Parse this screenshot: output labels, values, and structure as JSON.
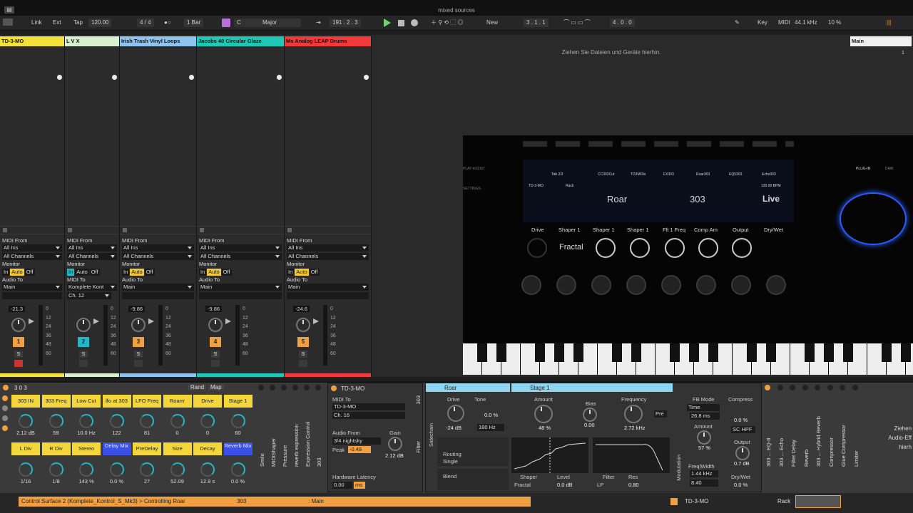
{
  "window": {
    "title": "mixed sources",
    "menu_glyph": "▤"
  },
  "transport": {
    "link": "Link",
    "ext": "Ext",
    "tap": "Tap",
    "tempo": "120.00",
    "meter": "4 / 4",
    "quant": "1 Bar",
    "key": "C",
    "scale": "Major",
    "position": "191 . 2 . 3",
    "new": "New",
    "loop_start": "3 . 1 . 1",
    "loop_len": "4 . 0 . 0",
    "key_btn": "Key",
    "midi": "MIDI",
    "sample_rate": "44.1 kHz",
    "cpu": "10 %"
  },
  "tracks": [
    {
      "name": "TD-3-MO",
      "color": "#f3e23a",
      "midi_from": "All Ins",
      "channels": "All Channels",
      "monitor": "auto",
      "audio_to": "Main",
      "sub": "",
      "volume": "-21.3",
      "number": "1",
      "numcolor": "#f0a040"
    },
    {
      "name": "L V X",
      "color": "#d8f0d0",
      "midi_from": "All Ins",
      "channels": "All Channels",
      "monitor": "in",
      "audio_to": "Komplete Kont",
      "sub": "Ch. 12",
      "volume": "",
      "number": "2",
      "numcolor": "#1fb8c8"
    },
    {
      "name": "Irish Trash Vinyl Loops",
      "color": "#8fc4f0",
      "midi_from": "All Ins",
      "channels": "All Channels",
      "monitor": "auto",
      "audio_to": "Main",
      "sub": "",
      "volume": "-9.86",
      "number": "3",
      "numcolor": "#f0a040"
    },
    {
      "name": "Jacobs 40 Circular Glaze",
      "color": "#1ec8b4",
      "midi_from": "All Ins",
      "channels": "All Channels",
      "monitor": "auto",
      "audio_to": "Main",
      "sub": "",
      "volume": "-9.86",
      "number": "4",
      "numcolor": "#f0a040"
    },
    {
      "name": "Ms Analog LEAP Drums",
      "color": "#f23a3a",
      "midi_from": "All Ins",
      "channels": "All Channels",
      "monitor": "auto",
      "audio_to": "Main",
      "sub": "",
      "volume": "-24.6",
      "number": "5",
      "numcolor": "#f0a040"
    }
  ],
  "labels": {
    "midi_from": "MIDI From",
    "monitor": "Monitor",
    "audio_to": "Audio To",
    "midi_to": "MIDI To",
    "in": "In",
    "auto": "Auto",
    "off": "Off",
    "s": "S",
    "meter_scale": [
      "0",
      "12",
      "24",
      "36",
      "48",
      "60"
    ]
  },
  "main_track": {
    "name": "Main",
    "num": "1"
  },
  "drop_message": "Ziehen Sie Dateien und Geräte hierhin.",
  "video": {
    "tab": "Tab 2/3",
    "tabs": [
      "CC303Cut",
      "TD3MOin",
      "FX303",
      "Roar303",
      "EQ5303",
      "Echo303"
    ],
    "track": "TD-3-MO",
    "rack": "Rack",
    "bpm": "120.00 BPM",
    "big_left": "Roar",
    "big_mid": "303",
    "big_right": "Live",
    "params": [
      "Drive",
      "Shaper 1",
      "Shaper 1",
      "Shaper 1",
      "Flt 1 Freq",
      "Comp Am",
      "Output",
      "Dry/Wet"
    ],
    "fractal": "Fractal",
    "top_left": "PLAY ASSIST",
    "top_left2": "SETTINGS",
    "plugin": "PLUG-IN",
    "daw": "DAW"
  },
  "rack": {
    "header": "3 0 3",
    "rand": "Rand",
    "map": "Map",
    "macros_top": [
      {
        "label": "303 IN",
        "value": "2.12 dB"
      },
      {
        "label": "303 Freq",
        "value": "59"
      },
      {
        "label": "Low Cut",
        "value": "10.0 Hz"
      },
      {
        "label": "lfo at 303",
        "value": "122"
      },
      {
        "label": "LFO Freq",
        "value": "81"
      },
      {
        "label": "Roarrr",
        "value": "0"
      },
      {
        "label": "Drive",
        "value": "0"
      },
      {
        "label": "Stage 1",
        "value": "60"
      }
    ],
    "macros_bottom": [
      {
        "label": "L Div",
        "value": "1/16"
      },
      {
        "label": "R Div",
        "value": "1/8"
      },
      {
        "label": "Stereo",
        "value": "143 %"
      },
      {
        "label": "Delay Mix",
        "value": "0.0 %"
      },
      {
        "label": "PreDelay",
        "value": "27"
      },
      {
        "label": "Size",
        "value": "52.09"
      },
      {
        "label": "Decay",
        "value": "12.9 s"
      },
      {
        "label": "Reverb Mix",
        "value": "0.0 %"
      }
    ],
    "chain_labels": [
      "Smile",
      "MIDIShaper",
      "Pressure",
      "reverb expression",
      "Expression Control",
      "303",
      "CC"
    ]
  },
  "td3": {
    "title": "TD-3-MO",
    "midi_to": "MIDI To",
    "midi_to_val": "TD-3-MO",
    "ch": "Ch. 16",
    "audio_from": "Audio From",
    "audio_from_val": "3/4 nightsky",
    "peak": "Peak",
    "peak_val": "-0.48",
    "gain": "Gain",
    "gain_val": "2.12 dB",
    "latency": "Hardware Latency",
    "latency_val": "0.00",
    "ms": "ms",
    "side_labels": [
      "303",
      "Filter",
      "MIDI In"
    ]
  },
  "roar": {
    "title": "Roar",
    "stage": "Stage 1",
    "drive": "Drive",
    "drive_val": "-24 dB",
    "tone": "Tone",
    "tone_val": "0.0 %",
    "tone_freq": "180 Hz",
    "routing": "Routing",
    "routing_val": "Single",
    "blend": "Blend",
    "sidechain": "Sidechain",
    "amount": "Amount",
    "amount_val": "48 %",
    "bias": "Bias",
    "bias_val": "0.00",
    "frequency": "Frequency",
    "frequency_val": "2.72 kHz",
    "pre": "Pre",
    "shaper": "Shaper",
    "shaper_val": "Fractal",
    "level": "Level",
    "level_val": "0.0 dB",
    "filter": "Filter",
    "filter_val": "LP",
    "res": "Res",
    "res_val": "0.80",
    "fb_mode": "FB Mode",
    "fb_mode_val": "Time",
    "fb_time": "26.8 ms",
    "fb_amount": "Amount",
    "fb_amount_val": "57 %",
    "freq_width": "Freq|Width",
    "freq_width_val": "1.44 kHz",
    "fw_val2": "8.40",
    "compress": "Compress",
    "compress_val": "0.0 %",
    "schpf": "SC HPF",
    "output": "Output",
    "output_val": "0.7 dB",
    "drywet": "Dry/Wet",
    "drywet_val": "0.0 %",
    "modulation": "Modulation"
  },
  "chain2": [
    "303 ... EQ-8",
    "303 ... Echo",
    "Filter Delay",
    "Reverb",
    "303 ... Hybrid Reverb",
    "Compressor",
    "Glue Compressor",
    "Limiter"
  ],
  "right_hint": [
    "Ziehen",
    "Audio-Eff",
    "hierh"
  ],
  "status": {
    "left": "Control Surface 2 (Komplete_Kontrol_S_Mk3) > Controlling Roar",
    "mid": "303",
    "main": ": Main",
    "track": "TD-3-MO",
    "rack": "Rack"
  }
}
